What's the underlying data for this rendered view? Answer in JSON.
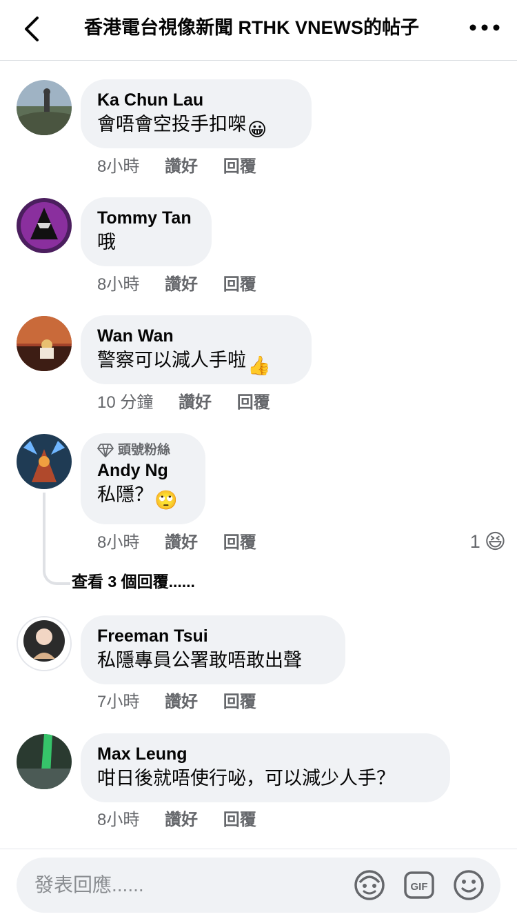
{
  "header": {
    "title": "香港電台視像新聞 RTHK VNEWS的帖子"
  },
  "comments": [
    {
      "author": "Ka Chun Lau",
      "text": "會唔會空投手扣㗎",
      "emoji": "😀",
      "time": "8小時",
      "like": "讚好",
      "reply": "回覆"
    },
    {
      "author": "Tommy Tan",
      "text": "哦",
      "time": "8小時",
      "like": "讚好",
      "reply": "回覆"
    },
    {
      "author": "Wan Wan",
      "text": "警察可以減人手啦",
      "emoji": "👍",
      "time": "10 分鐘",
      "like": "讚好",
      "reply": "回覆"
    },
    {
      "badge": "頭號粉絲",
      "author": "Andy Ng",
      "text": "私隱？",
      "emoji": "🙄",
      "time": "8小時",
      "like": "讚好",
      "reply": "回覆",
      "reaction_count": "1",
      "reaction_emoji": "😆",
      "view_replies": "查看 3 個回覆......"
    },
    {
      "author": "Freeman Tsui",
      "text": "私隱專員公署敢唔敢出聲",
      "time": "7小時",
      "like": "讚好",
      "reply": "回覆"
    },
    {
      "author": "Max Leung",
      "text": "咁日後就唔使行咇，可以減少人手？",
      "time": "8小時",
      "like": "讚好",
      "reply": "回覆"
    }
  ],
  "composer": {
    "placeholder": "發表回應......",
    "icons": [
      "avatar-sticker-icon",
      "gif-icon",
      "emoji-icon"
    ]
  }
}
